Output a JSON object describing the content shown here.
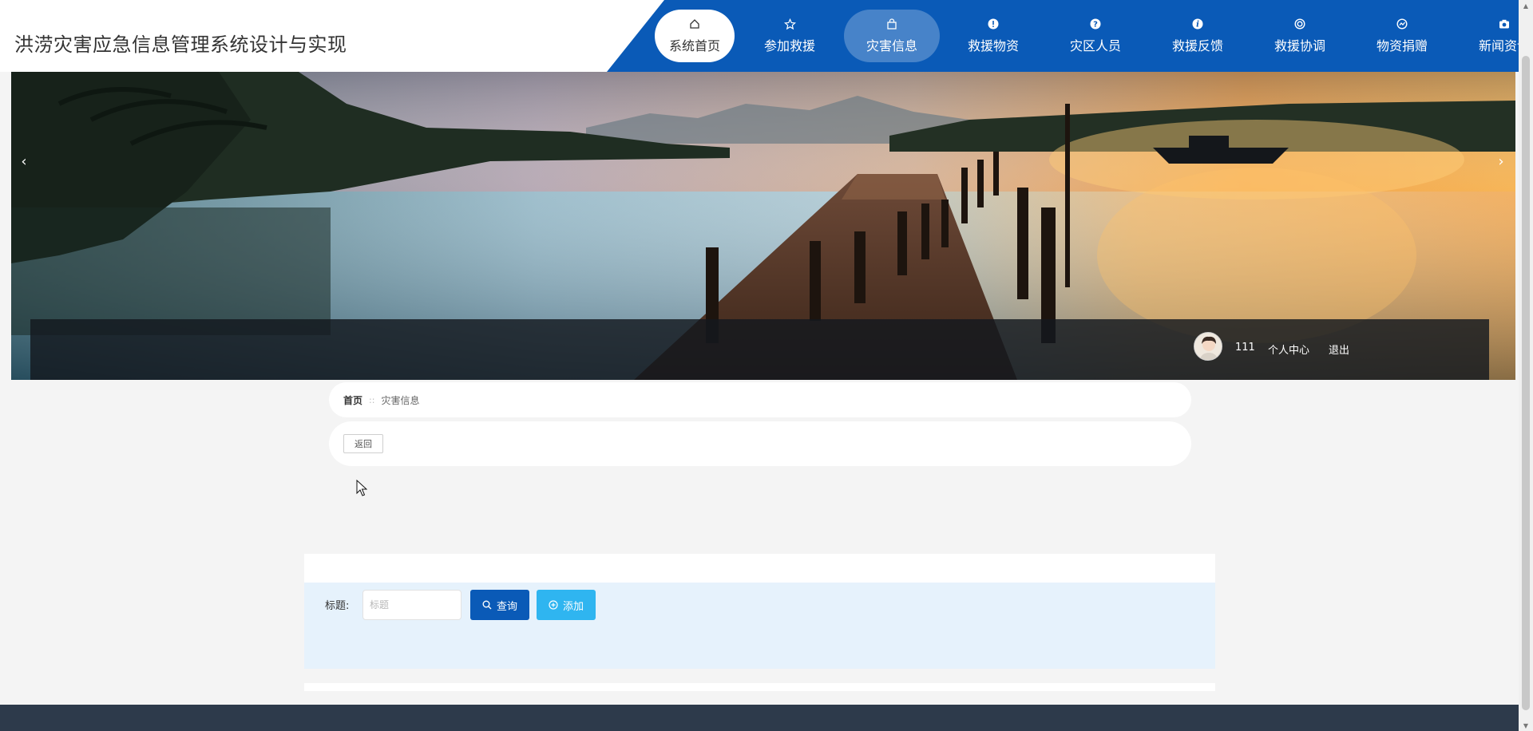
{
  "header": {
    "site_title": "洪涝灾害应急信息管理系统设计与实现",
    "nav_color": "#0a5ab7",
    "nav": [
      {
        "label": "系统首页",
        "icon": "home-icon"
      },
      {
        "label": "参加救援",
        "icon": "star-icon"
      },
      {
        "label": "灾害信息",
        "icon": "bag-icon"
      },
      {
        "label": "救援物资",
        "icon": "exclamation-icon"
      },
      {
        "label": "灾区人员",
        "icon": "question-icon"
      },
      {
        "label": "救援反馈",
        "icon": "info-icon"
      },
      {
        "label": "救援协调",
        "icon": "ring-icon"
      },
      {
        "label": "物资捐赠",
        "icon": "gauge-icon"
      },
      {
        "label": "新闻资讯",
        "icon": "camera-icon"
      }
    ],
    "active_nav": "灾害信息"
  },
  "banner": {
    "prev_arrow": "‹",
    "next_arrow": "›"
  },
  "user_bar": {
    "username": "111",
    "profile_label": "个人中心",
    "logout_label": "退出"
  },
  "breadcrumb": {
    "home": "首页",
    "separator": "::",
    "current": "灾害信息"
  },
  "back_button": "返回",
  "search": {
    "label": "标题:",
    "placeholder": "标题",
    "query_label": "查询",
    "add_label": "添加",
    "query_color": "#0a5ab7",
    "add_color": "#2fb5f0"
  },
  "footer_color": "#2d3a4b"
}
